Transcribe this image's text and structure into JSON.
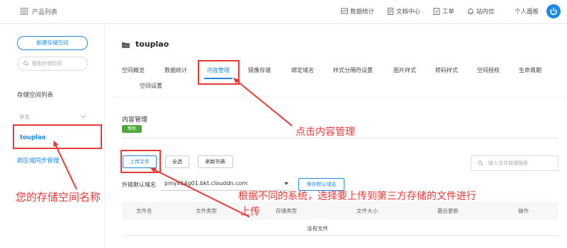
{
  "app": {
    "title": "产品列表"
  },
  "topnav": {
    "items": [
      {
        "label": "数据统计",
        "icon": "chart-icon"
      },
      {
        "label": "文档中心",
        "icon": "document-icon"
      },
      {
        "label": "工单",
        "icon": "ticket-icon"
      },
      {
        "label": "站内信",
        "icon": "bell-icon"
      }
    ],
    "profile_label": "个人面板"
  },
  "sidebar": {
    "new_bucket_label": "新建存储空间",
    "search_placeholder": "搜索存储空间",
    "list_title": "存储空间列表",
    "region": "华北",
    "bucket_name": "touplao",
    "sync_label": "跨区域同步管理"
  },
  "main": {
    "bucket_title": "touplao",
    "tabs": [
      {
        "label": "空间概览"
      },
      {
        "label": "数据统计"
      },
      {
        "label": "内容管理",
        "active": true
      },
      {
        "label": "镜像存储"
      },
      {
        "label": "绑定域名"
      },
      {
        "label": "样式分隔符设置"
      },
      {
        "label": "图片样式"
      },
      {
        "label": "转码样式"
      },
      {
        "label": "空间授权"
      },
      {
        "label": "生命周期"
      },
      {
        "label": "空间设置"
      }
    ],
    "section_title": "内容管理",
    "help_badge": "帮助",
    "toolbar": {
      "upload_label": "上传文件",
      "select_all_label": "全选",
      "refresh_label": "刷新列表",
      "search_placeholder": "输入文件前缀搜索"
    },
    "domain": {
      "label": "外链默认域名",
      "value": "pmyx54g01.bkt.clouddn.com",
      "save_label": "保存默认域名"
    },
    "table": {
      "columns": [
        "文件名",
        "文件类型",
        "存储类型",
        "文件大小",
        "最后更新",
        "操作"
      ],
      "empty_text": "没有文件"
    }
  },
  "annotations": {
    "click_content": "点击内容管理",
    "bucket_name": "您的存储空间名称",
    "upload_line1": "根据不同的系统，选择要上传到第三方存储的文件进行",
    "upload_line2": "上传"
  },
  "colors": {
    "accent": "#1e88e5",
    "annotation": "#e53935",
    "help": "#52a73a"
  }
}
